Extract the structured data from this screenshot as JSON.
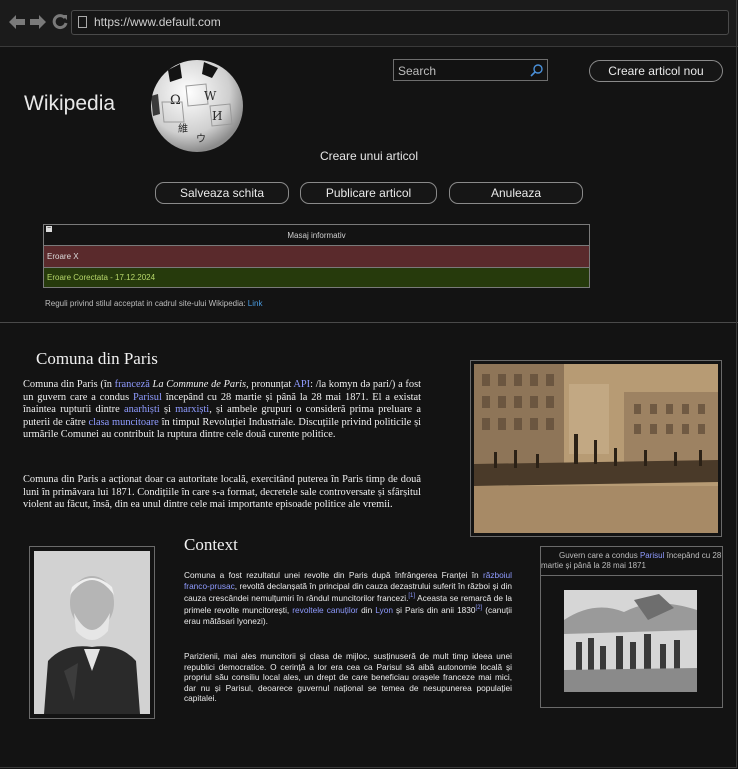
{
  "browser": {
    "url": "https://www.default.com"
  },
  "header": {
    "site_title": "Wikipedia",
    "logo_glyphs": [
      "Ω",
      "W",
      "И",
      "維",
      "ウ"
    ],
    "search_placeholder": "Search",
    "create_article_button": "Creare articol nou",
    "page_subtitle": "Creare unui articol",
    "actions": {
      "save_draft": "Salveaza schita",
      "publish": "Publicare articol",
      "cancel": "Anuleaza"
    }
  },
  "messages": {
    "title": "Masaj informativ",
    "toggle": "−",
    "error": "Eroare X",
    "fixed": "Eroare Corectata - 17.12.2024"
  },
  "style_rules": {
    "text": "Reguli privind stilul acceptat in cadrul site-ului Wikipedia:",
    "link": "Link"
  },
  "article": {
    "title": "Comuna din Paris",
    "intro_p1": [
      "Comuna din Paris (în ",
      "franceză",
      " ",
      "La Commune de Paris",
      ", pronunțat ",
      "API",
      ": /la komyn də pari/) a fost un guvern care a condus ",
      "Parisul",
      " începând cu 28 martie și până la 28 mai 1871. El a existat înaintea rupturii dintre ",
      "anarhiști",
      " și ",
      "marxiști",
      ", și ambele grupuri o consideră prima preluare a puterii de către ",
      "clasa muncitoare",
      " în timpul Revoluției Industriale. Discuțiile privind politicile și urmările Comunei au contribuit la ruptura dintre cele două curente politice."
    ],
    "intro_p2": "Comuna din Paris a acționat doar ca autoritate locală, exercitând puterea în Paris timp de două luni în primăvara lui 1871. Condițiile în care s-a format, decretele sale controversate și sfârșitul violent au făcut, însă, din ea unul dintre cele mai importante episoade politice ale vremii.",
    "context_title": "Context",
    "context_p1": [
      "Comuna a fost rezultatul unei revolte din Paris după înfrângerea Franței în ",
      "războiul franco-prusac",
      ", revoltă declanșată în principal din cauza dezastrului suferit în război și din cauza crescândei nemulțumiri în rândul muncitorilor francezi.",
      "[1]",
      " Aceasta se remarcă de la primele revolte muncitorești, ",
      "revoltele canuților",
      " din ",
      "Lyon",
      " și Paris din anii 1830",
      "[2]",
      " (canuții erau mătăsari lyonezi)."
    ],
    "context_p2": "Parizienii, mai ales muncitorii și clasa de mijloc, susținuseră de mult timp ideea unei republici democratice. O cerință a lor era cea ca Parisul să aibă autonomie locală și propriul său consiliu local ales, un drept de care beneficiau orașele franceze mai mici, dar nu și Parisul, deoarece guvernul național se temea de nesupunerea populației capitalei.",
    "caption": [
      "Guvern care a condus ",
      "Parisul",
      " începând cu 28 martie și până la 28 mai 1871"
    ]
  },
  "colors": {
    "background": "#131313",
    "link": "#8f9bff",
    "error_bg": "#5a2a2c",
    "success_bg": "#263a0c"
  }
}
